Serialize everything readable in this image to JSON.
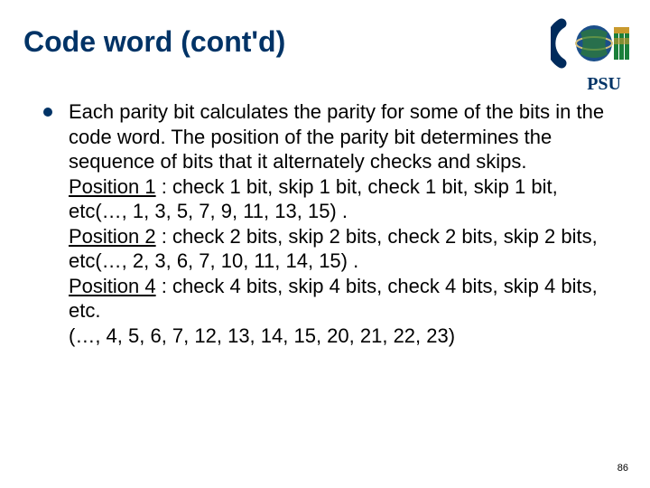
{
  "slide": {
    "title": "Code word (cont'd)",
    "psu_label": "PSU",
    "page_number": "86",
    "bullet": {
      "intro": "Each parity bit calculates the parity for some of the bits in the code word. The position of the parity bit determines the sequence of bits that it alternately checks and skips.",
      "positions": [
        {
          "label": "Position 1",
          "rule": " : check 1 bit, skip 1 bit, check 1 bit, skip 1 bit, etc(…, 1, 3, 5, 7, 9, 11, 13, 15) ."
        },
        {
          "label": "Position 2",
          "rule": " : check 2 bits, skip 2 bits, check 2 bits, skip 2 bits, etc(…, 2, 3, 6, 7, 10, 11, 14, 15) ."
        },
        {
          "label": "Position 4",
          "rule": " : check 4 bits, skip 4 bits, check 4 bits, skip 4 bits, etc."
        }
      ],
      "tail": "(…, 4, 5, 6, 7, 12, 13, 14, 15, 20, 21, 22, 23)"
    }
  }
}
